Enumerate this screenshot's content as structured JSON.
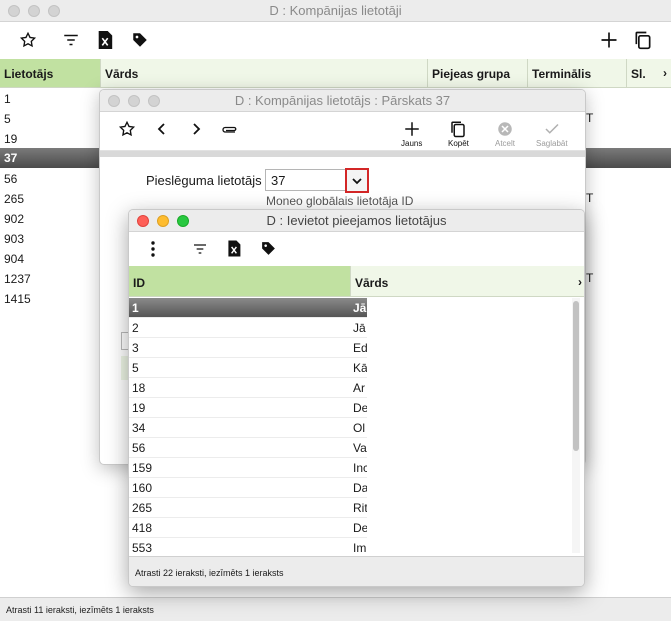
{
  "main": {
    "title": "D : Kompānijas lietotāji",
    "columns": [
      "Lietotājs",
      "Vārds",
      "Piejeas grupa",
      "Terminālis",
      "Sl."
    ],
    "rows": [
      "1",
      "5",
      "19",
      "37",
      "56",
      "265",
      "902",
      "903",
      "904",
      "1237",
      "1415"
    ],
    "selected_row": "37",
    "status": "Atrasti 11 ieraksti, iezīmēts 1 ieraksts",
    "icons": [
      "star-icon",
      "filter-icon",
      "excel-icon",
      "tag-icon",
      "plus-icon",
      "copy-icon"
    ],
    "partial_col_text": [
      "T",
      "T",
      "T"
    ]
  },
  "overview": {
    "title": "D : Kompānijas lietotājs : Pārskats 37",
    "toolbar": {
      "new_label": "Jauns",
      "copy_label": "Kopēt",
      "cancel_label": "Atcelt",
      "save_label": "Saglabāt"
    },
    "field_label": "Pieslēguma lietotājs",
    "field_value": "37",
    "field_hint": "Moneo globālais lietotāja ID"
  },
  "lookup": {
    "title": "D : Ievietot pieejamos lietotājus",
    "col_id": "ID",
    "col_name": "Vārds",
    "rows": [
      {
        "id": "1",
        "name": "Jā"
      },
      {
        "id": "2",
        "name": "Jā"
      },
      {
        "id": "3",
        "name": "Ed"
      },
      {
        "id": "5",
        "name": "Kā"
      },
      {
        "id": "18",
        "name": "Ar"
      },
      {
        "id": "19",
        "name": "De"
      },
      {
        "id": "34",
        "name": "Ol"
      },
      {
        "id": "56",
        "name": "Va"
      },
      {
        "id": "159",
        "name": "Inc"
      },
      {
        "id": "160",
        "name": "Da"
      },
      {
        "id": "265",
        "name": "Rit"
      },
      {
        "id": "418",
        "name": "De"
      },
      {
        "id": "553",
        "name": "Im"
      }
    ],
    "status": "Atrasti 22 ieraksti, iezīmēts 1 ieraksts"
  }
}
